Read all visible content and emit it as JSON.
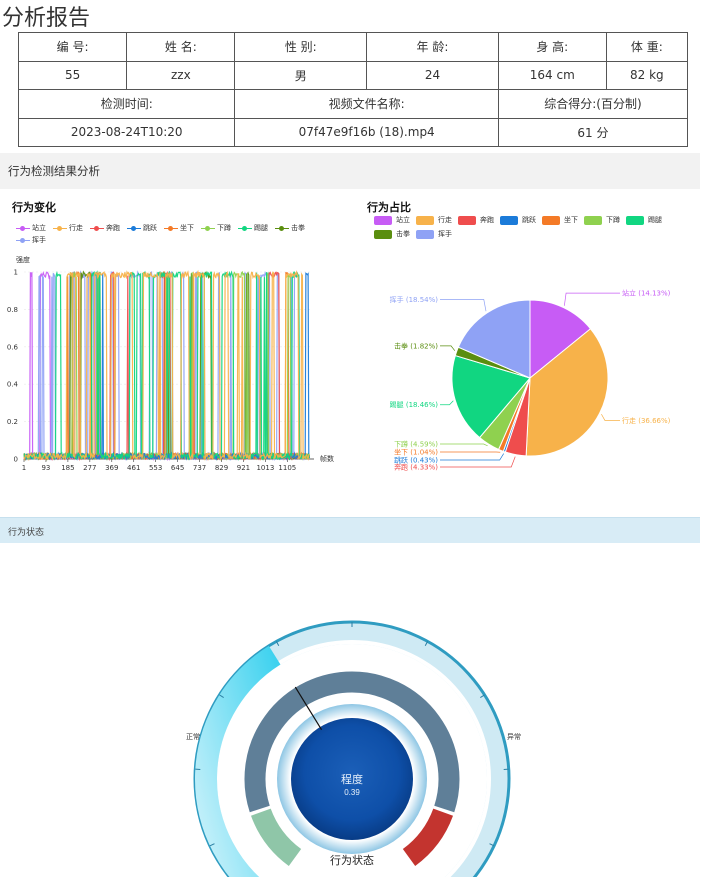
{
  "page": {
    "title": "分析报告"
  },
  "info": {
    "headers": [
      "编 号:",
      "姓 名:",
      "性 别:",
      "年 龄:",
      "身 高:",
      "体 重:"
    ],
    "values": [
      "55",
      "zzx",
      "男",
      "24",
      "164 cm",
      "82 kg"
    ],
    "headers2": [
      "检测时间:",
      "视频文件名称:",
      "综合得分:(百分制)"
    ],
    "values2": [
      "2023-08-24T10:20",
      "07f47e9f16b (18).mp4",
      "61 分"
    ]
  },
  "sections": {
    "analysis": "行为检测结果分析",
    "state": "行为状态"
  },
  "colors": [
    "#c75cf5",
    "#f7b24a",
    "#ef4d4d",
    "#1b7bd9",
    "#f47a27",
    "#8fd14f",
    "#11d681",
    "#5a8e0f",
    "#8fa2f5"
  ],
  "chart_data": [
    {
      "type": "line",
      "title": "行为变化",
      "ylabel": "强度",
      "xlabel": "帧数",
      "ylim": [
        0,
        1
      ],
      "yticks": [
        "0",
        "0.2",
        "0.4",
        "0.6",
        "0.8",
        "1"
      ],
      "xticks": [
        "1",
        "93",
        "185",
        "277",
        "369",
        "461",
        "553",
        "645",
        "737",
        "829",
        "921",
        "1013",
        "1105"
      ],
      "series": [
        {
          "name": "站立"
        },
        {
          "name": "行走"
        },
        {
          "name": "奔跑"
        },
        {
          "name": "跳跃"
        },
        {
          "name": "坐下"
        },
        {
          "name": "下蹲"
        },
        {
          "name": "踢腿"
        },
        {
          "name": "击拳"
        },
        {
          "name": "挥手"
        }
      ],
      "legend": "top"
    },
    {
      "type": "pie",
      "title": "行为占比",
      "slices": [
        {
          "name": "站立",
          "value": 14.13,
          "label": "站立 (14.13%)"
        },
        {
          "name": "行走",
          "value": 36.66,
          "label": "行走 (36.66%)"
        },
        {
          "name": "奔跑",
          "value": 4.33,
          "label": "奔跑 (4.33%)"
        },
        {
          "name": "跳跃",
          "value": 0.43,
          "label": "跳跃 (0.43%)"
        },
        {
          "name": "坐下",
          "value": 1.04,
          "label": "坐下 (1.04%)"
        },
        {
          "name": "下蹲",
          "value": 4.59,
          "label": "下蹲 (4.59%)"
        },
        {
          "name": "踢腿",
          "value": 18.46,
          "label": "踢腿 (18.46%)"
        },
        {
          "name": "击拳",
          "value": 1.82,
          "label": "击拳 (1.82%)"
        },
        {
          "name": "挥手",
          "value": 18.54,
          "label": "挥手 (18.54%)"
        }
      ],
      "legend": "top"
    }
  ],
  "gauge": {
    "title": "行为状态",
    "center_label": "程度",
    "value": 0.39,
    "value_text": "0.39",
    "left_label": "正常",
    "right_label": "异常"
  }
}
